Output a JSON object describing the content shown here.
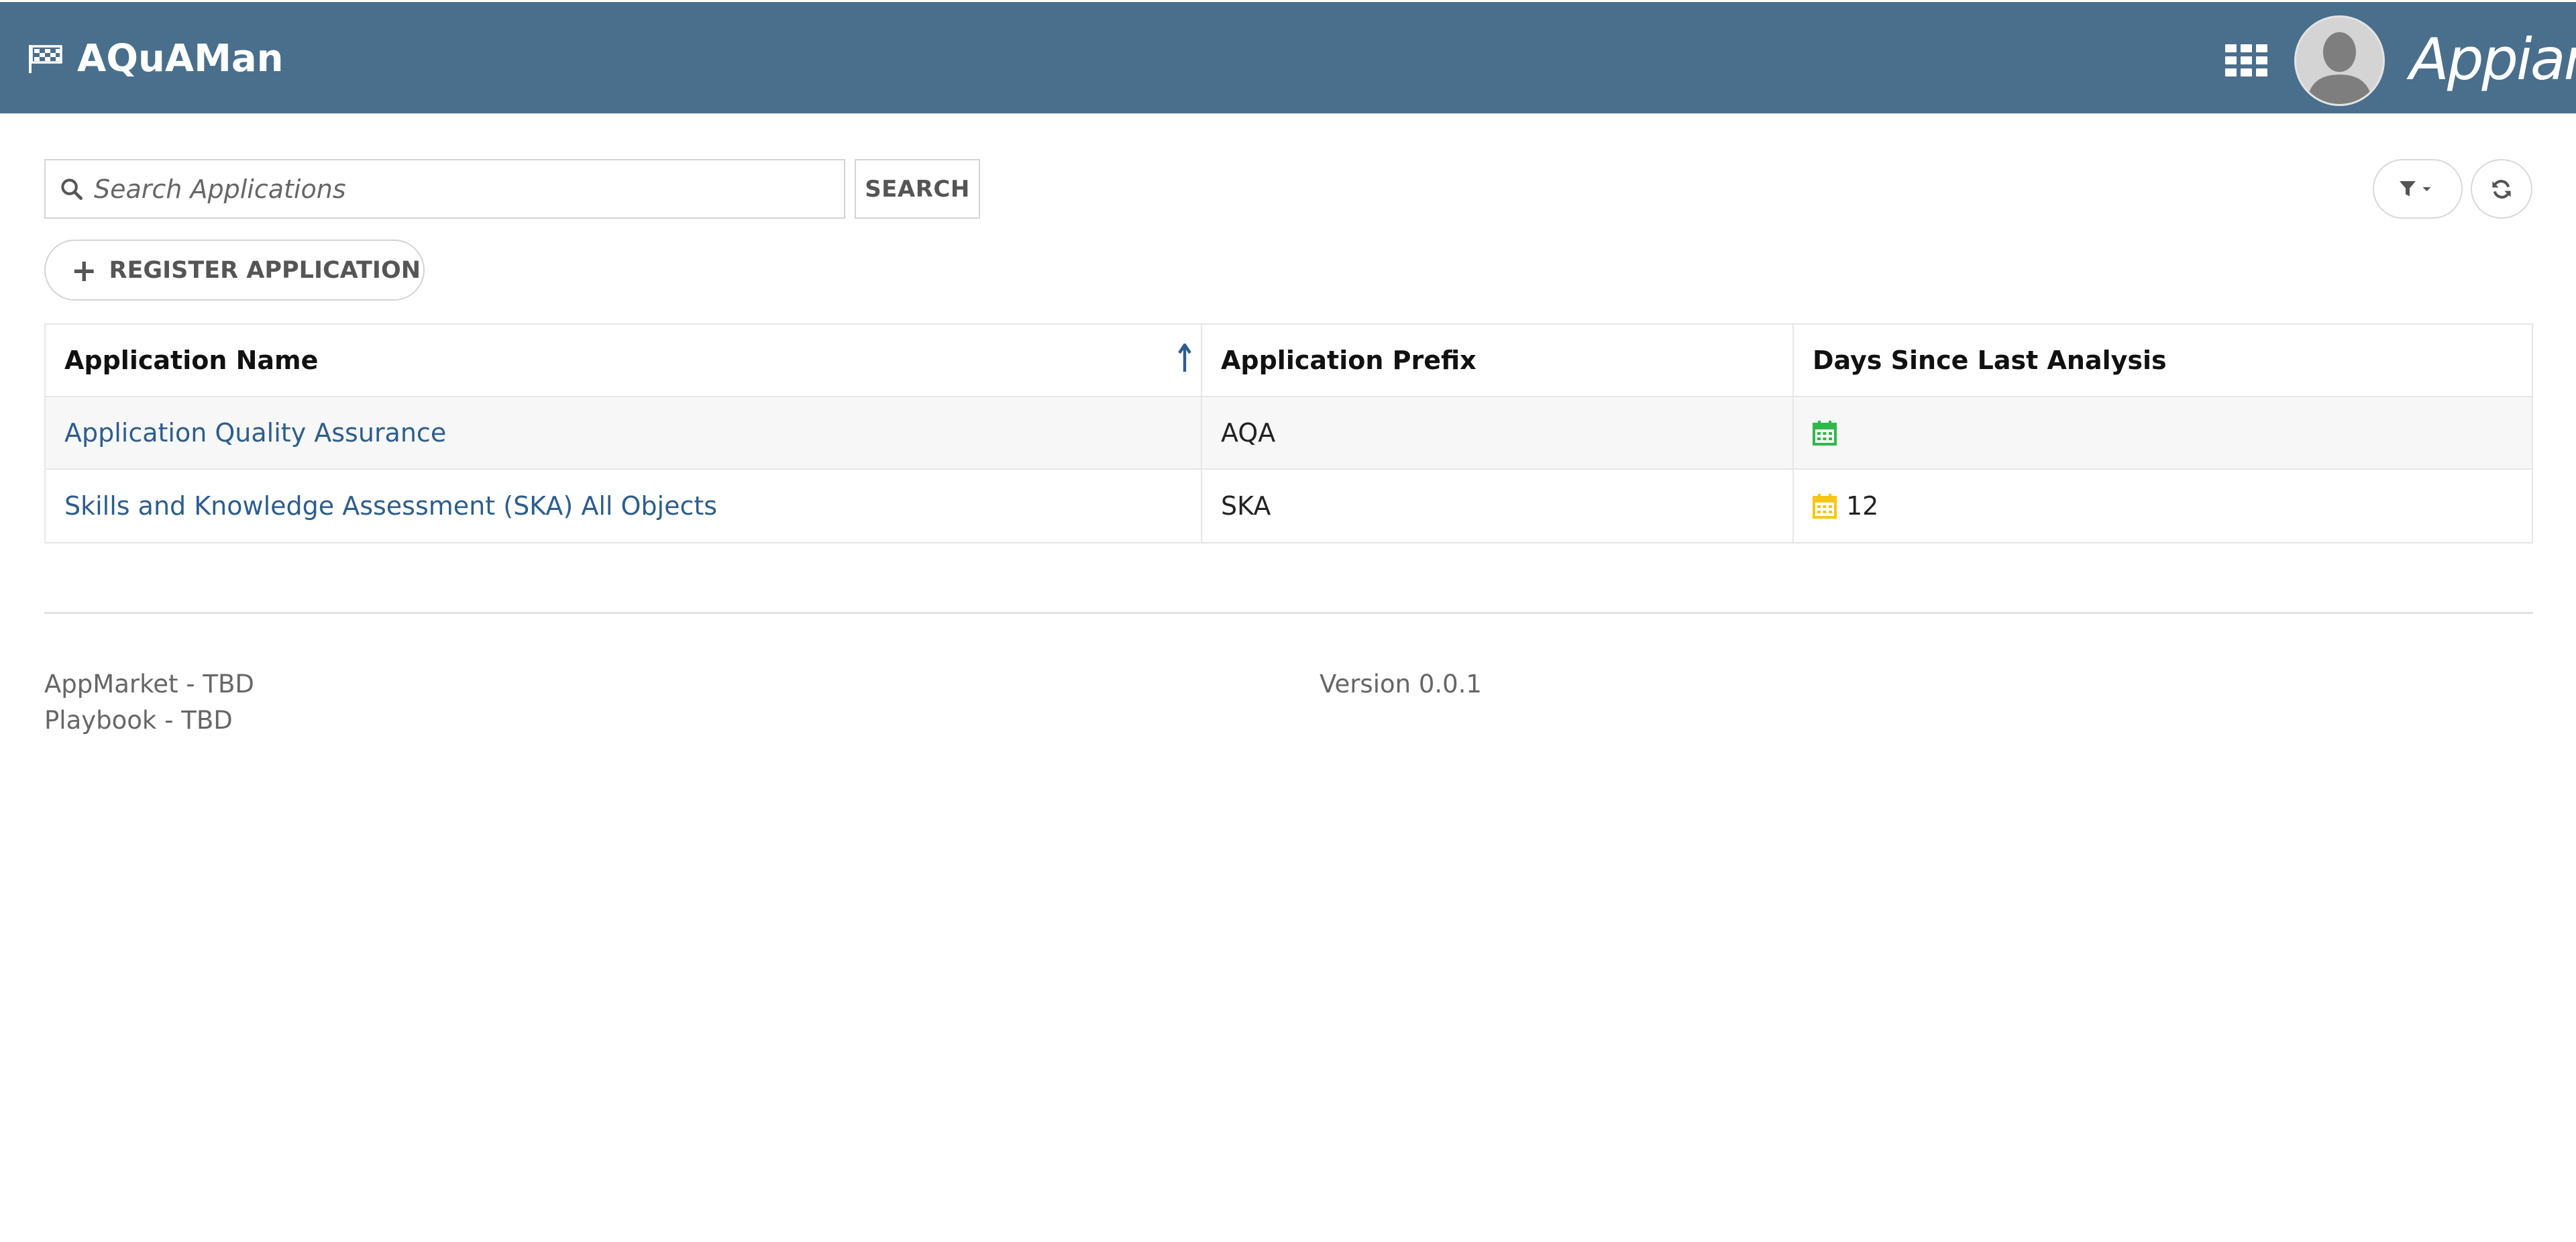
{
  "header": {
    "app_name": "AQuAMan",
    "brand": "Appian",
    "colors": {
      "bar": "#4a6f8c",
      "link": "#2d5d8c",
      "calendar_recent": "#2fb84a",
      "calendar_stale": "#f5c518"
    }
  },
  "toolbar": {
    "search_placeholder": "Search Applications",
    "search_value": "",
    "search_label": "SEARCH",
    "register_label": "REGISTER APPLICATION"
  },
  "table": {
    "columns": [
      "Application Name",
      "Application Prefix",
      "Days Since Last Analysis"
    ],
    "sort": {
      "column": "Application Name",
      "direction": "ascending"
    },
    "rows": [
      {
        "name": "Application Quality Assurance",
        "prefix": "AQA",
        "days": "",
        "calendar_status": "recent"
      },
      {
        "name": "Skills and Knowledge Assessment (SKA) All Objects",
        "prefix": "SKA",
        "days": "12",
        "calendar_status": "stale"
      }
    ]
  },
  "footer": {
    "appmarket": "AppMarket - TBD",
    "playbook": "Playbook - TBD",
    "version": "Version 0.0.1"
  },
  "icons": [
    "flag-icon",
    "app-launcher-grid-icon",
    "user-avatar",
    "search-icon",
    "filter-icon",
    "chevron-down-icon",
    "refresh-icon",
    "plus-icon",
    "sort-ascending-icon",
    "calendar-icon"
  ]
}
